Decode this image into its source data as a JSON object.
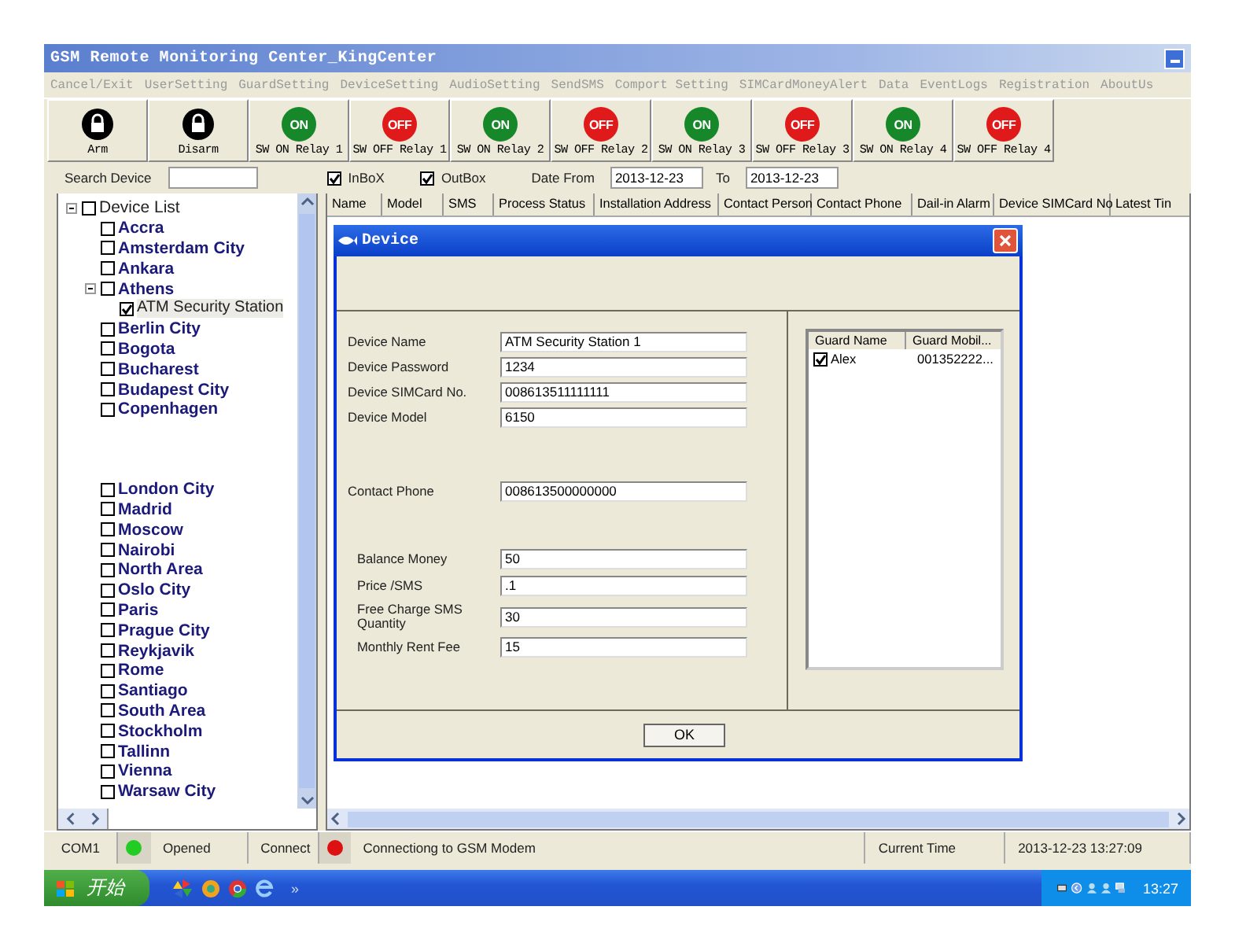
{
  "window": {
    "title": "GSM Remote Monitoring Center_KingCenter"
  },
  "menu": [
    {
      "label": "Cancel/Exit",
      "disabled": true
    },
    {
      "label": "UserSetting",
      "disabled": true
    },
    {
      "label": "GuardSetting",
      "disabled": true
    },
    {
      "label": "DeviceSetting",
      "disabled": true
    },
    {
      "label": "AudioSetting",
      "disabled": true
    },
    {
      "label": "SendSMS",
      "disabled": true
    },
    {
      "label": "Comport Setting",
      "disabled": true
    },
    {
      "label": "SIMCardMoneyAlert",
      "disabled": true
    },
    {
      "label": "Data",
      "disabled": true
    },
    {
      "label": "EventLogs",
      "disabled": true
    },
    {
      "label": "Registration",
      "disabled": true
    },
    {
      "label": "AboutUs",
      "disabled": true
    }
  ],
  "toolbar": [
    {
      "kind": "lock",
      "label": "Arm"
    },
    {
      "kind": "lock",
      "label": "Disarm"
    },
    {
      "kind": "on",
      "badge": "ON",
      "label": "SW ON Relay 1"
    },
    {
      "kind": "off",
      "badge": "OFF",
      "label": "SW OFF Relay 1"
    },
    {
      "kind": "on",
      "badge": "ON",
      "label": "SW ON Relay 2"
    },
    {
      "kind": "off",
      "badge": "OFF",
      "label": "SW OFF Relay 2"
    },
    {
      "kind": "on",
      "badge": "ON",
      "label": "SW ON Relay 3"
    },
    {
      "kind": "off",
      "badge": "OFF",
      "label": "SW OFF Relay 3"
    },
    {
      "kind": "on",
      "badge": "ON",
      "label": "SW ON Relay 4"
    },
    {
      "kind": "off",
      "badge": "OFF",
      "label": "SW OFF Relay 4"
    }
  ],
  "filter": {
    "search_label": "Search Device",
    "inbox": {
      "label": "InBoX",
      "checked": true
    },
    "outbox": {
      "label": "OutBox",
      "checked": true
    },
    "date_from_label": "Date From",
    "date_from": "2013-12-23",
    "to_label": "To",
    "date_to": "2013-12-23"
  },
  "tree": {
    "label": "Device List",
    "checked": false,
    "expanded": true,
    "children": [
      {
        "label": "Accra",
        "checked": false
      },
      {
        "label": "Amsterdam City",
        "checked": false
      },
      {
        "label": "Ankara",
        "checked": false
      },
      {
        "label": "Athens",
        "checked": false,
        "expanded": true,
        "children": [
          {
            "label": "ATM Security Station",
            "checked": true,
            "selected": true
          }
        ]
      },
      {
        "label": "Berlin City",
        "checked": false
      },
      {
        "label": "Bogota",
        "checked": false
      },
      {
        "label": "Bucharest",
        "checked": false
      },
      {
        "label": "Budapest City",
        "checked": false
      },
      {
        "label": "Copenhagen",
        "checked": false
      },
      {
        "label": "London City",
        "checked": false
      },
      {
        "label": "Madrid",
        "checked": false
      },
      {
        "label": "Moscow",
        "checked": false
      },
      {
        "label": "Nairobi",
        "checked": false
      },
      {
        "label": "North Area",
        "checked": false
      },
      {
        "label": "Oslo City",
        "checked": false
      },
      {
        "label": "Paris",
        "checked": false
      },
      {
        "label": "Prague City",
        "checked": false
      },
      {
        "label": "Reykjavik",
        "checked": false
      },
      {
        "label": "Rome",
        "checked": false
      },
      {
        "label": "Santiago",
        "checked": false
      },
      {
        "label": "South Area",
        "checked": false
      },
      {
        "label": "Stockholm",
        "checked": false
      },
      {
        "label": "Tallinn",
        "checked": false
      },
      {
        "label": "Vienna",
        "checked": false
      },
      {
        "label": "Warsaw City",
        "checked": false
      }
    ]
  },
  "table": {
    "columns": [
      "Name",
      "Model",
      "SMS",
      "Process Status",
      "Installation Address",
      "Contact Person",
      "Contact Phone",
      "Dail-in Alarm",
      "Device SIMCard No",
      "Latest Tin"
    ]
  },
  "dialog": {
    "title": "Device",
    "field_groups": [
      [
        {
          "label": "Device Name",
          "value": "ATM Security Station 1"
        },
        {
          "label": "Device Password",
          "value": "1234"
        },
        {
          "label": "Device SIMCard No.",
          "value": "008613511111111"
        },
        {
          "label": "Device Model",
          "value": "6150"
        }
      ],
      [
        {
          "label": "Contact Phone",
          "value": "008613500000000"
        }
      ],
      [
        {
          "label": "Balance Money",
          "value": "50"
        },
        {
          "label": "Price /SMS",
          "value": ".1"
        },
        {
          "label": "Free Charge SMS Quantity",
          "value": "30"
        },
        {
          "label": "Monthly Rent Fee",
          "value": "15"
        }
      ]
    ],
    "guards": {
      "columns": [
        "Guard Name",
        "Guard Mobil..."
      ],
      "rows": [
        {
          "checked": true,
          "cells": [
            "Alex",
            "001352222..."
          ]
        }
      ]
    },
    "ok": "OK"
  },
  "status_bar": [
    {
      "kind": "text",
      "text": "COM1"
    },
    {
      "kind": "dot",
      "color": "#22cc22"
    },
    {
      "kind": "text",
      "text": "Opened"
    },
    {
      "kind": "text",
      "text": "Connect"
    },
    {
      "kind": "dot",
      "color": "#dd1111"
    },
    {
      "kind": "wide",
      "text": "Connectiong to GSM Modem"
    },
    {
      "kind": "text",
      "text": "Current Time"
    },
    {
      "kind": "text",
      "text": "2013-12-23 13:27:09"
    }
  ],
  "taskbar": {
    "start": "开始",
    "more": "»",
    "clock": "13:27"
  }
}
